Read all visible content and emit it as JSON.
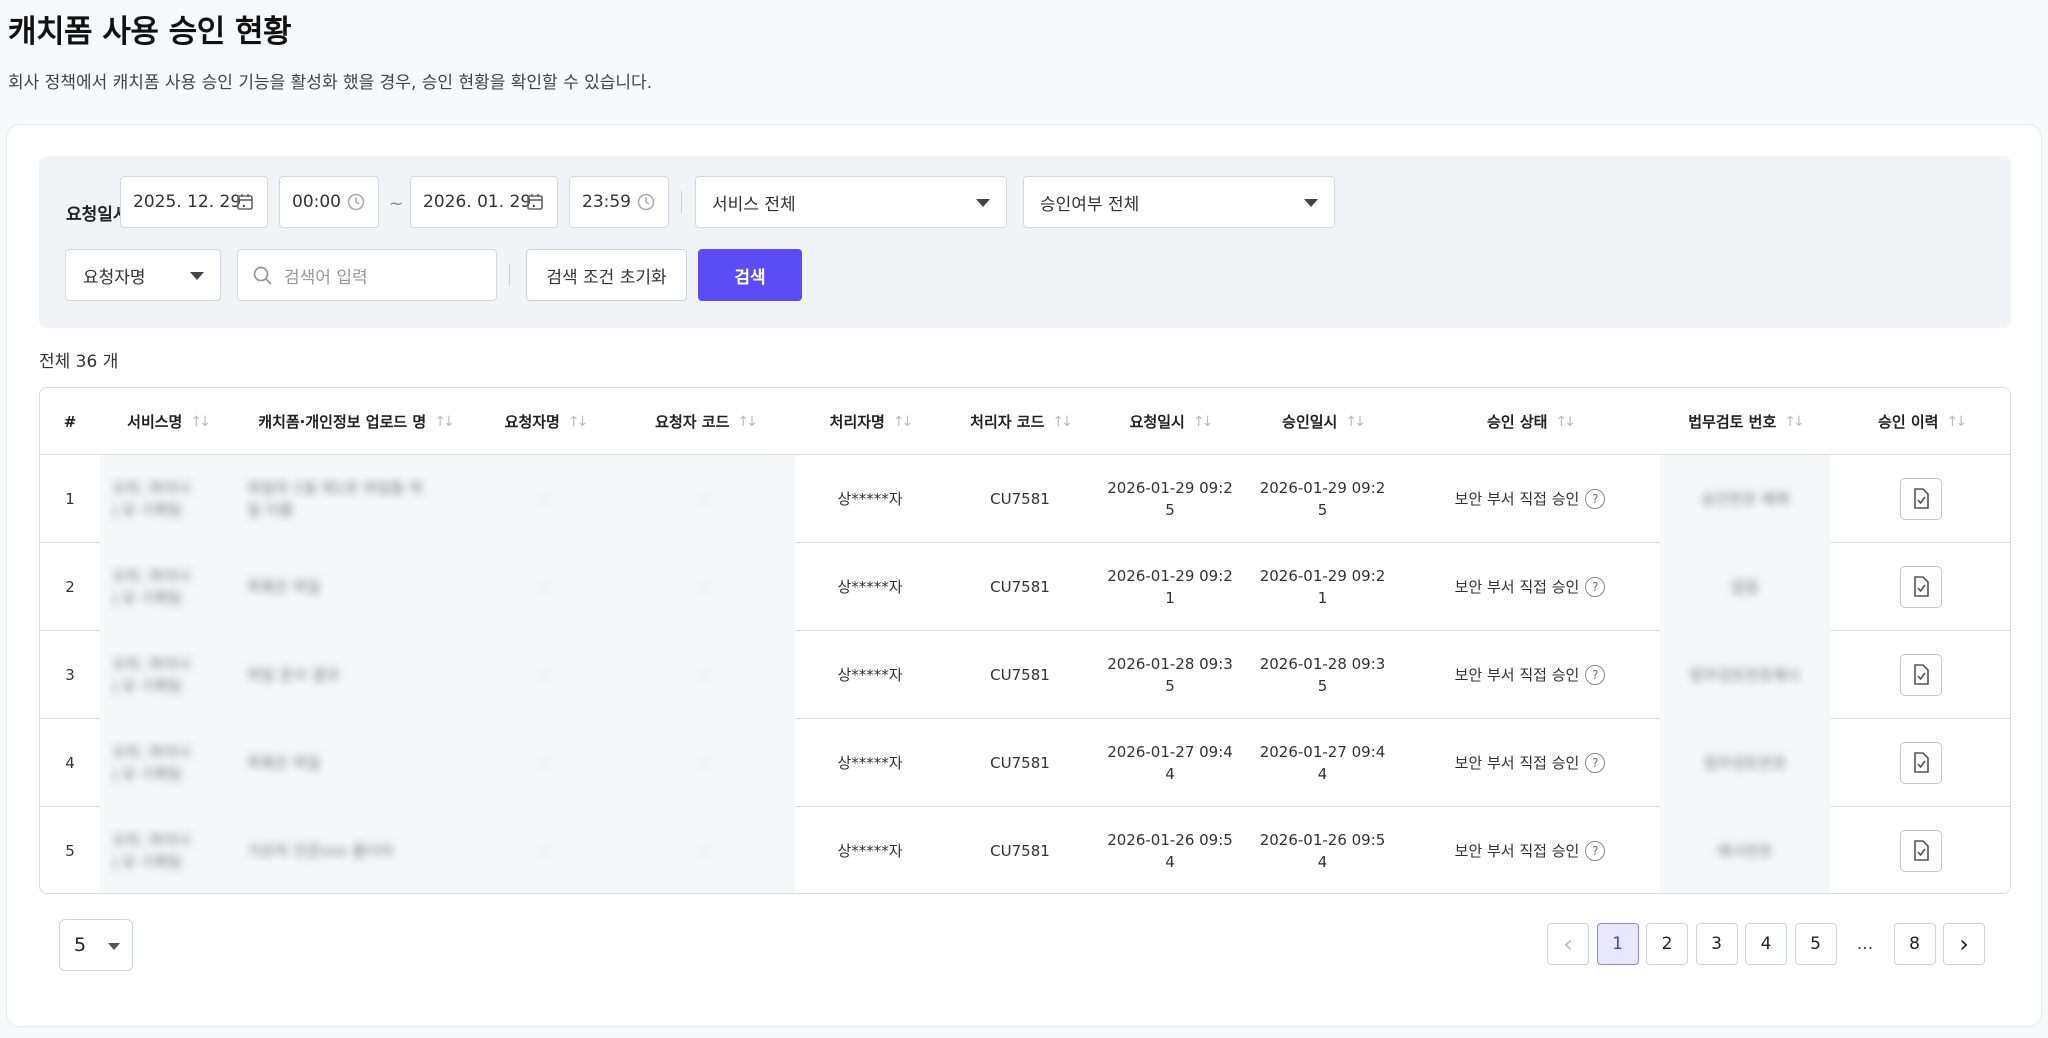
{
  "page": {
    "title": "캐치폼 사용 승인 현황",
    "description": "회사 정책에서 캐치폼 사용 승인 기능을 활성화 했을 경우, 승인 현황을 확인할 수 있습니다."
  },
  "filters": {
    "date_label": "요청일시",
    "start_date": "2025. 12. 29.",
    "start_time": "00:00",
    "tilde": "~",
    "end_date": "2026. 01. 29.",
    "end_time": "23:59",
    "service_select": "서비스 전체",
    "approval_select": "승인여부 전체",
    "field_select": "요청자명",
    "search_placeholder": "검색어 입력",
    "reset_label": "검색 조건 초기화",
    "search_label": "검색"
  },
  "total_text": "전체 36 개",
  "table": {
    "columns": [
      "#",
      "서비스명",
      "캐치폼·개인정보 업로드 명",
      "요청자명",
      "요청자 코드",
      "처리자명",
      "처리자 코드",
      "요청일시",
      "승인일시",
      "승인 상태",
      "법무검토 번호",
      "승인 이력"
    ],
    "rows": [
      {
        "no": "1",
        "service": "오피, 파이너 | 유 기획팀",
        "upload": "파일의 1월 제1호 파일돌 파일 이름",
        "requester": "-",
        "requester_code": "-",
        "processor": "상*****자",
        "processor_code": "CU7581",
        "request_time": "2026-01-29 09:25",
        "approve_time": "2026-01-29 09:25",
        "status": "보안 부서 직접 승인",
        "legal_no": "승인번호 예제"
      },
      {
        "no": "2",
        "service": "오피, 파이너 | 유 기획팀",
        "upload": "목록은 파일",
        "requester": "-",
        "requester_code": "-",
        "processor": "상*****자",
        "processor_code": "CU7581",
        "request_time": "2026-01-29 09:21",
        "approve_time": "2026-01-29 09:21",
        "status": "보안 부서 직접 승인",
        "legal_no": "없음"
      },
      {
        "no": "3",
        "service": "오피, 파이너 | 유 기획팀",
        "upload": "파일 문서 결과",
        "requester": "-",
        "requester_code": "-",
        "processor": "상*****자",
        "processor_code": "CU7581",
        "request_time": "2026-01-28 09:35",
        "approve_time": "2026-01-28 09:35",
        "status": "보안 부서 직접 승인",
        "legal_no": "법무검토번호예시"
      },
      {
        "no": "4",
        "service": "오피, 파이너 | 유 기획팀",
        "upload": "목록은 파일",
        "requester": "-",
        "requester_code": "-",
        "processor": "상*****자",
        "processor_code": "CU7581",
        "request_time": "2026-01-27 09:44",
        "approve_time": "2026-01-27 09:44",
        "status": "보안 부서 직접 승인",
        "legal_no": "법무검토번호"
      },
      {
        "no": "5",
        "service": "오피, 파이너 | 유 기획팀",
        "upload": "가로막 전문xxx 폴더자",
        "requester": "-",
        "requester_code": "-",
        "processor": "상*****자",
        "processor_code": "CU7581",
        "request_time": "2026-01-26 09:54",
        "approve_time": "2026-01-26 09:54",
        "status": "보안 부서 직접 승인",
        "legal_no": "예시번호"
      }
    ]
  },
  "pagination": {
    "page_size": "5",
    "prev": "‹",
    "next": "›",
    "pages": [
      "1",
      "2",
      "3",
      "4",
      "5"
    ],
    "ellipsis": "...",
    "last": "8",
    "current": "1"
  },
  "colors": {
    "accent": "#5b4df6",
    "active_page_bg": "#e9e7ff"
  },
  "icons": [
    "calendar-icon",
    "clock-icon",
    "search-icon",
    "sort-icon",
    "help-icon",
    "history-doc-icon"
  ]
}
